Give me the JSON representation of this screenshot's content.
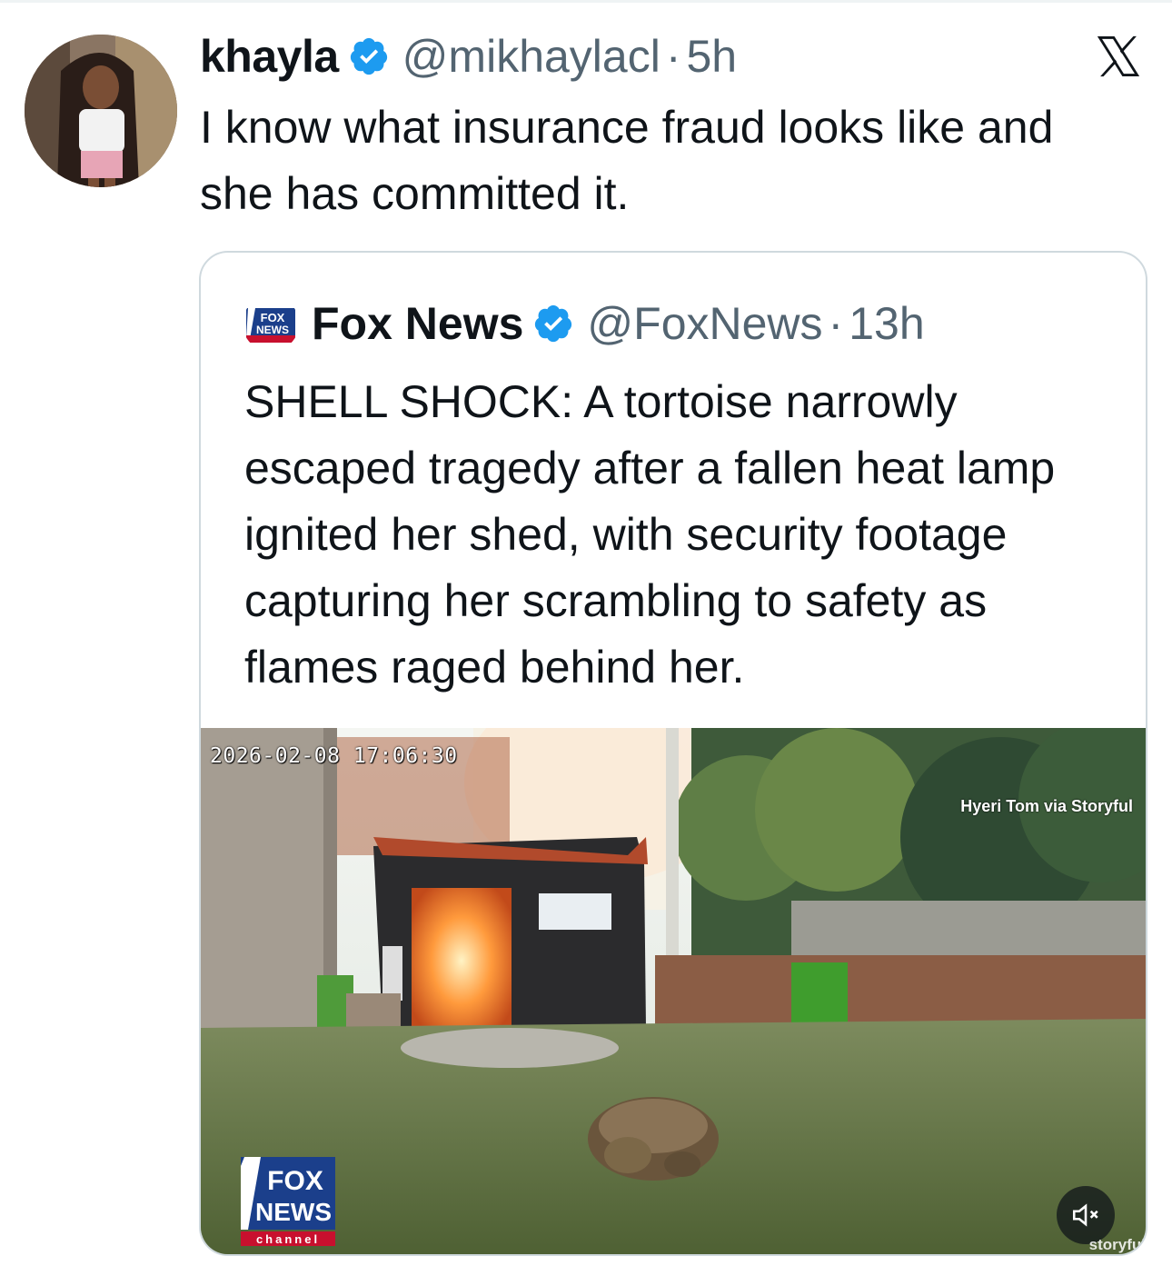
{
  "post": {
    "author_name": "khayla",
    "author_handle": "@mikhaylacl",
    "separator": "·",
    "time": "5h",
    "text": "I know what insurance fraud looks like and she has committed it."
  },
  "quoted_post": {
    "author_name": "Fox News",
    "author_handle": "@FoxNews",
    "separator": "·",
    "time": "13h",
    "text": "SHELL SHOCK: A tortoise narrowly escaped tragedy after a fallen heat lamp ignited her shed, with security footage capturing her scrambling to safety as flames raged behind her.",
    "media": {
      "timestamp_overlay": "2026-02-08 17:06:30",
      "credit_overlay": "Hyeri Tom via Storyful",
      "watermark": "storyful",
      "logo_text": "FOX NEWS channel",
      "sound_icon": "muted-speaker-icon"
    }
  },
  "icons": {
    "verified": "verified-badge-icon",
    "platform": "x-logo-icon"
  },
  "colors": {
    "verified_blue": "#1d9bf0",
    "secondary_text": "#536471",
    "border": "#cfd9de"
  }
}
